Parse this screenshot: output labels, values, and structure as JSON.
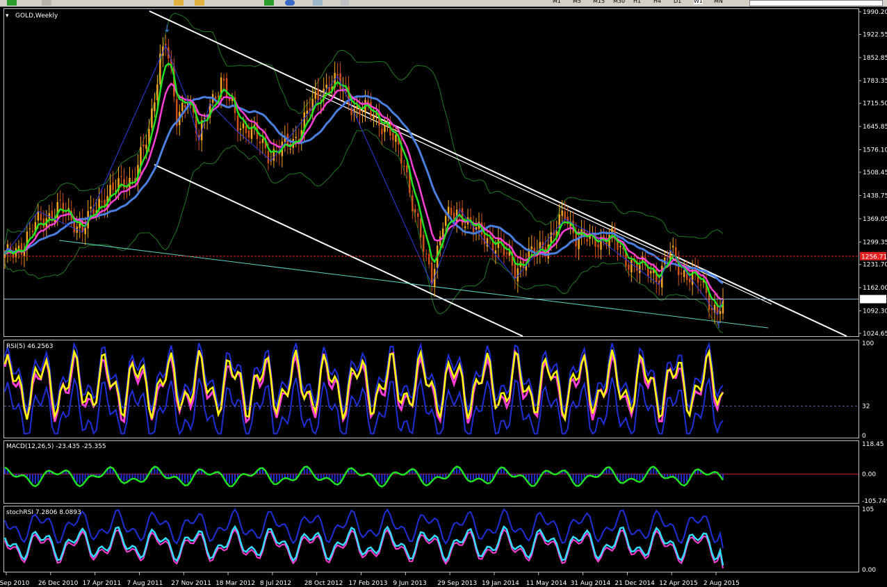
{
  "toolbar": {
    "timeframes": [
      "M1",
      "M5",
      "M15",
      "M30",
      "H1",
      "H4",
      "D1",
      "W1",
      "MN"
    ],
    "active_timeframe": "W1"
  },
  "panels": {
    "main": {
      "label": "GOLD,Weekly"
    },
    "rsi": {
      "label": "RSI(5) 46.2563"
    },
    "macd": {
      "label": "MACD(12,26,5) -23.435 -25.355"
    },
    "stochrsi": {
      "label": "stochRSI 7.2806 8.0893"
    }
  },
  "colors": {
    "background": "#000000",
    "bull_candle": "#f5a623",
    "bear_candle": "#d0521b",
    "ema_fast": "#22e022",
    "ema_mid": "#ff3fd6",
    "sma_slow": "#4a7fe0",
    "bollinger": "#1f7a1f",
    "trendline": "#ffffff",
    "support": "#5fd0c0",
    "rsi_line": "#ffff00",
    "macd_line": "#22e022",
    "macd_hist": "#1f2fd6",
    "stoch_line": "#33ddff"
  },
  "chart_data": [
    {
      "type": "candlestick",
      "title": "GOLD,Weekly",
      "ylim": [
        1024.65,
        1990.2
      ],
      "yticks": [
        "1990.20",
        "1922.55",
        "1852.85",
        "1783.35",
        "1715.50",
        "1645.85",
        "1576.10",
        "1508.45",
        "1438.75",
        "1369.05",
        "1299.35",
        "1231.70",
        "1162.00",
        "1092.30",
        "1024.65"
      ],
      "xticks": [
        "5 Sep 2010",
        "26 Dec 2010",
        "17 Apr 2011",
        "7 Aug 2011",
        "27 Nov 2011",
        "18 Mar 2012",
        "8 Jul 2012",
        "28 Oct 2012",
        "17 Feb 2013",
        "9 Jun 2013",
        "29 Sep 2013",
        "19 Jan 2014",
        "11 May 2014",
        "31 Aug 2014",
        "21 Dec 2014",
        "12 Apr 2015",
        "2 Aug 2015"
      ],
      "reference_lines": [
        {
          "name": "red_level",
          "value": 1256.71,
          "label": "1256.71"
        },
        {
          "name": "current_price",
          "value": 1127.72,
          "label": "1127.72"
        }
      ],
      "close_path": [
        [
          "5 Sep 2010",
          1250
        ],
        [
          "26 Dec 2010",
          1380
        ],
        [
          "17 Apr 2011",
          1500
        ],
        [
          "7 Aug 2011",
          1900
        ],
        [
          "27 Nov 2011",
          1720
        ],
        [
          "18 Mar 2012",
          1640
        ],
        [
          "8 Jul 2012",
          1590
        ],
        [
          "28 Oct 2012",
          1770
        ],
        [
          "17 Feb 2013",
          1610
        ],
        [
          "9 Jun 2013",
          1220
        ],
        [
          "29 Sep 2013",
          1330
        ],
        [
          "19 Jan 2014",
          1250
        ],
        [
          "11 May 2014",
          1300
        ],
        [
          "31 Aug 2014",
          1280
        ],
        [
          "21 Dec 2014",
          1200
        ],
        [
          "12 Apr 2015",
          1200
        ],
        [
          "2 Aug 2015",
          1127.72
        ]
      ]
    },
    {
      "type": "line",
      "title": "RSI(5) 46.2563",
      "ylim": [
        0,
        100
      ],
      "yticks": [
        "100",
        "32",
        "0"
      ],
      "levels": [
        32
      ],
      "last_value": 46.2563
    },
    {
      "type": "line",
      "title": "MACD(12,26,5) -23.435 -25.355",
      "ylim": [
        -105.749,
        118.45
      ],
      "yticks": [
        "118.45",
        "0.00",
        "-105.749"
      ],
      "macd": -23.435,
      "signal": -25.355
    },
    {
      "type": "line",
      "title": "stochRSI 7.2806 8.0893",
      "ylim": [
        0,
        105
      ],
      "yticks": [
        "105",
        "0.00"
      ],
      "k": 7.2806,
      "d": 8.0893
    }
  ]
}
